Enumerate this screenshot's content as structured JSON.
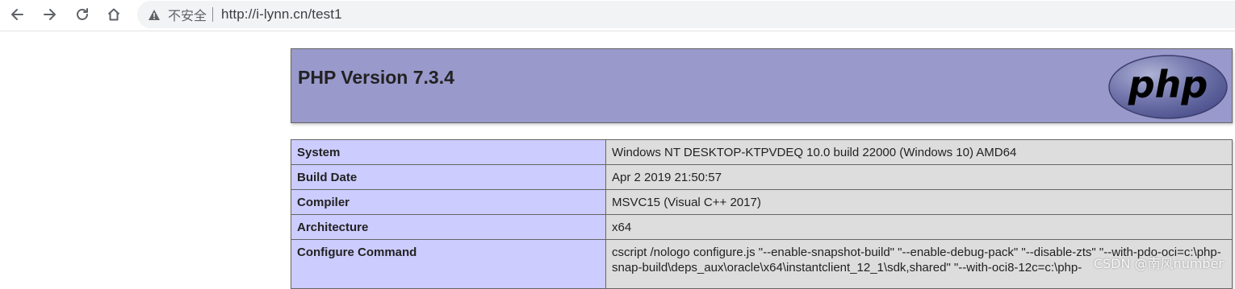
{
  "browser": {
    "security_label": "不安全",
    "url": "http://i-lynn.cn/test1"
  },
  "header": {
    "title": "PHP Version 7.3.4",
    "logo_text": "php"
  },
  "info_rows": [
    {
      "key": "System",
      "value": "Windows NT DESKTOP-KTPVDEQ 10.0 build 22000 (Windows 10) AMD64"
    },
    {
      "key": "Build Date",
      "value": "Apr 2 2019 21:50:57"
    },
    {
      "key": "Compiler",
      "value": "MSVC15 (Visual C++ 2017)"
    },
    {
      "key": "Architecture",
      "value": "x64"
    },
    {
      "key": "Configure Command",
      "value": "cscript /nologo configure.js \"--enable-snapshot-build\" \"--enable-debug-pack\" \"--disable-zts\" \"--with-pdo-oci=c:\\php-snap-build\\deps_aux\\oracle\\x64\\instantclient_12_1\\sdk,shared\" \"--with-oci8-12c=c:\\php-"
    }
  ],
  "watermark": "CSDN @南风number",
  "colors": {
    "header_bg": "#9999cc",
    "key_bg": "#ccccff",
    "value_bg": "#dddddd"
  }
}
